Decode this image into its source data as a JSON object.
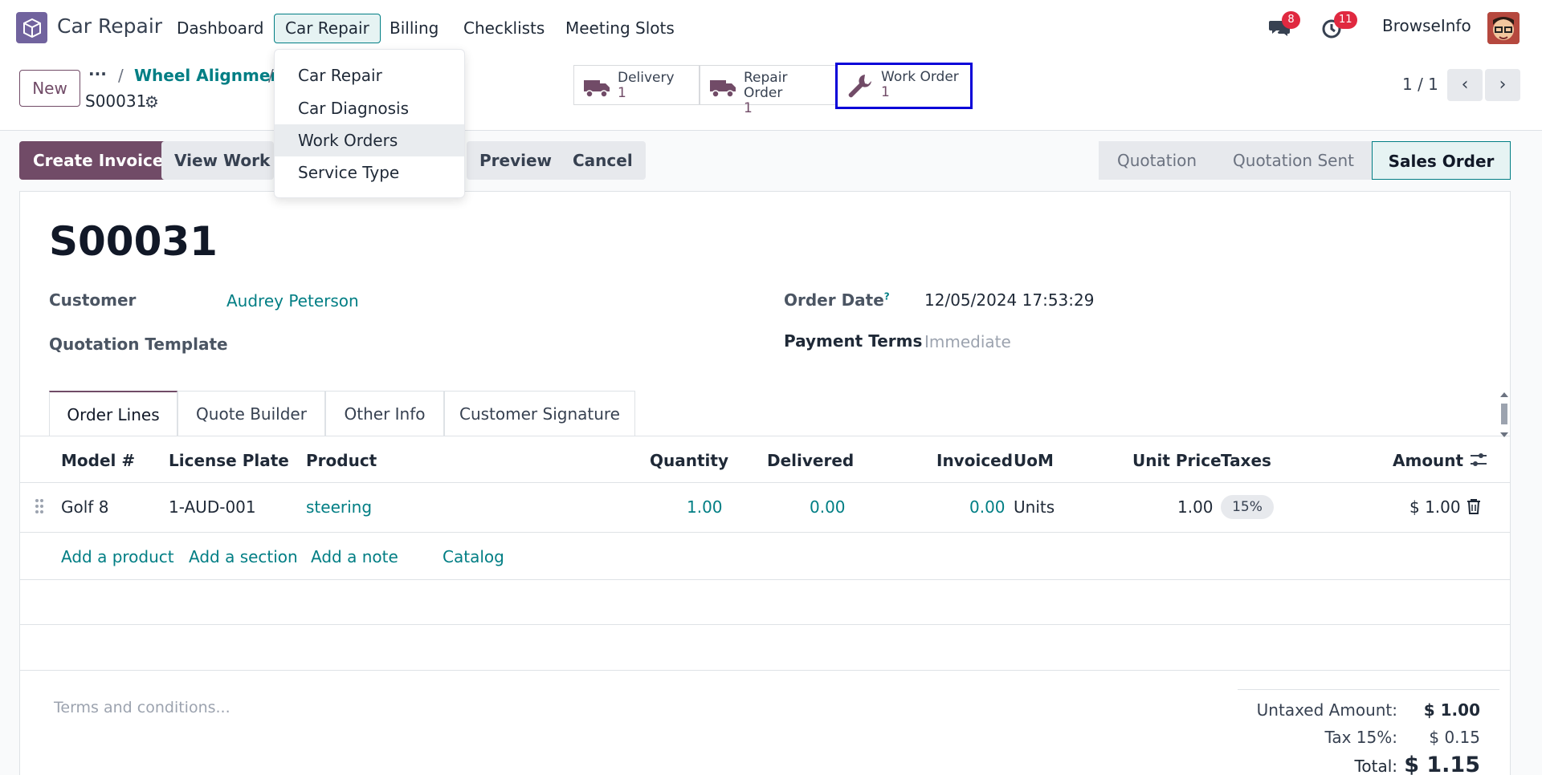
{
  "navbar": {
    "app_name": "Car Repair",
    "menu": [
      "Dashboard",
      "Car Repair",
      "Billing",
      "Checklists",
      "Meeting Slots"
    ],
    "messages_badge": "8",
    "activities_badge": "11",
    "company": "BrowseInfo"
  },
  "dropdown": {
    "items": [
      "Car Repair",
      "Car Diagnosis",
      "Work Orders",
      "Service Type"
    ]
  },
  "control_panel": {
    "new_label": "New",
    "breadcrumb_dots": "···",
    "breadcrumb_sep": "/",
    "breadcrumb_parent": "Wheel Alignment",
    "record_name": "S00031",
    "smart_buttons": [
      {
        "label": "Delivery",
        "count": "1"
      },
      {
        "label": "Repair Order",
        "count": "1"
      },
      {
        "label": "Work Order",
        "count": "1"
      }
    ],
    "pager": "1 / 1"
  },
  "statusbar": {
    "create_invoice": "Create Invoice",
    "view_work": "View Work O",
    "preview": "Preview",
    "cancel": "Cancel",
    "stages": [
      "Quotation",
      "Quotation Sent",
      "Sales Order"
    ]
  },
  "form": {
    "title": "S00031",
    "customer_label": "Customer",
    "customer_value": "Audrey Peterson",
    "template_label": "Quotation Template",
    "order_date_label": "Order Date",
    "order_date_help": "?",
    "order_date_value": "12/05/2024 17:53:29",
    "payment_terms_label": "Payment Terms",
    "payment_terms_value": "Immediate"
  },
  "tabs": [
    "Order Lines",
    "Quote Builder",
    "Other Info",
    "Customer Signature"
  ],
  "table": {
    "headers": [
      "Model #",
      "License Plate",
      "Product",
      "Quantity",
      "Delivered",
      "Invoiced",
      "UoM",
      "Unit Price",
      "Taxes",
      "Amount"
    ],
    "row": {
      "model": "Golf 8",
      "plate": "1-AUD-001",
      "product": "steering",
      "quantity": "1.00",
      "delivered": "0.00",
      "invoiced": "0.00",
      "uom": "Units",
      "unit_price": "1.00",
      "taxes": "15%",
      "amount": "$ 1.00"
    },
    "add_links": [
      "Add a product",
      "Add a section",
      "Add a note",
      "Catalog"
    ]
  },
  "footer": {
    "terms_placeholder": "Terms and conditions...",
    "untaxed_label": "Untaxed Amount:",
    "untaxed_value": "$ 1.00",
    "tax_label": "Tax 15%:",
    "tax_value": "$ 0.15",
    "total_label": "Total:",
    "total_value": "$ 1.15"
  },
  "colors": {
    "brand": "#714b67",
    "link": "#017e84",
    "badge": "#e02940",
    "highlight_border": "#0a00d8"
  }
}
